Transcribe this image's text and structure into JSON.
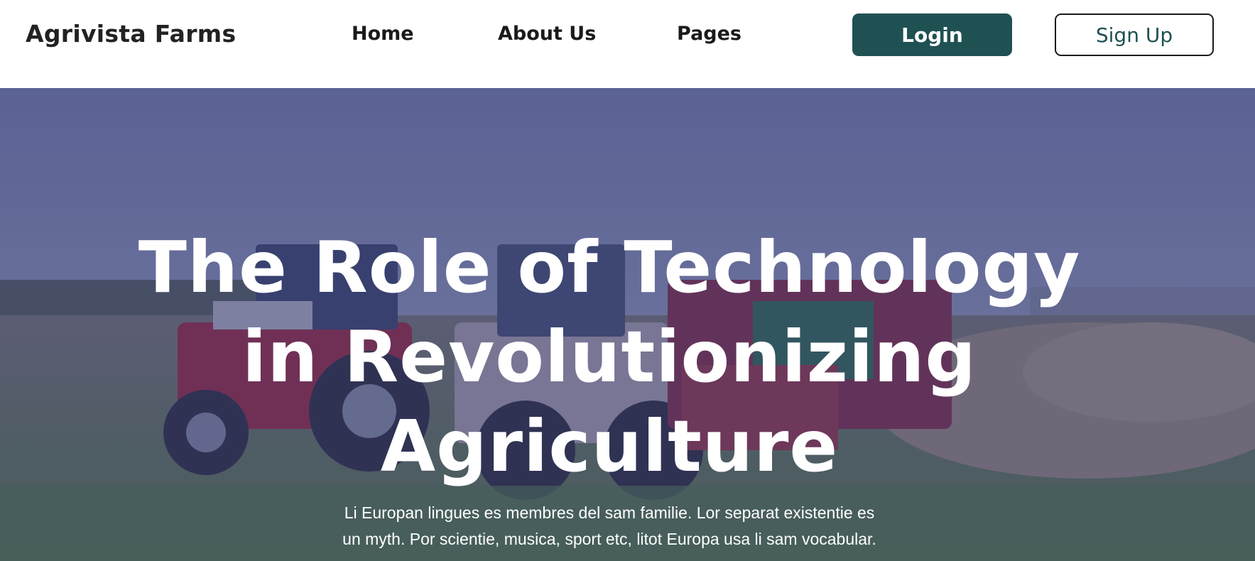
{
  "header": {
    "brand": "Agrivista Farms",
    "nav": {
      "home": "Home",
      "about": "About Us",
      "pages": "Pages"
    },
    "login_label": "Login",
    "signup_label": "Sign Up"
  },
  "hero": {
    "title_lines": [
      "The Role of Technology",
      "in Revolutionizing",
      "Agriculture"
    ],
    "text_lines": [
      "Li Europan lingues es membres del sam familie. Lor separat existentie es",
      "un myth. Por scientie, musica, sport etc, litot Europa usa li sam vocabular."
    ],
    "background_image": "farm-tractors-field"
  },
  "colors": {
    "accent": "#1f5153",
    "overlay": "#343876",
    "text_dark": "#1a1a1a"
  }
}
